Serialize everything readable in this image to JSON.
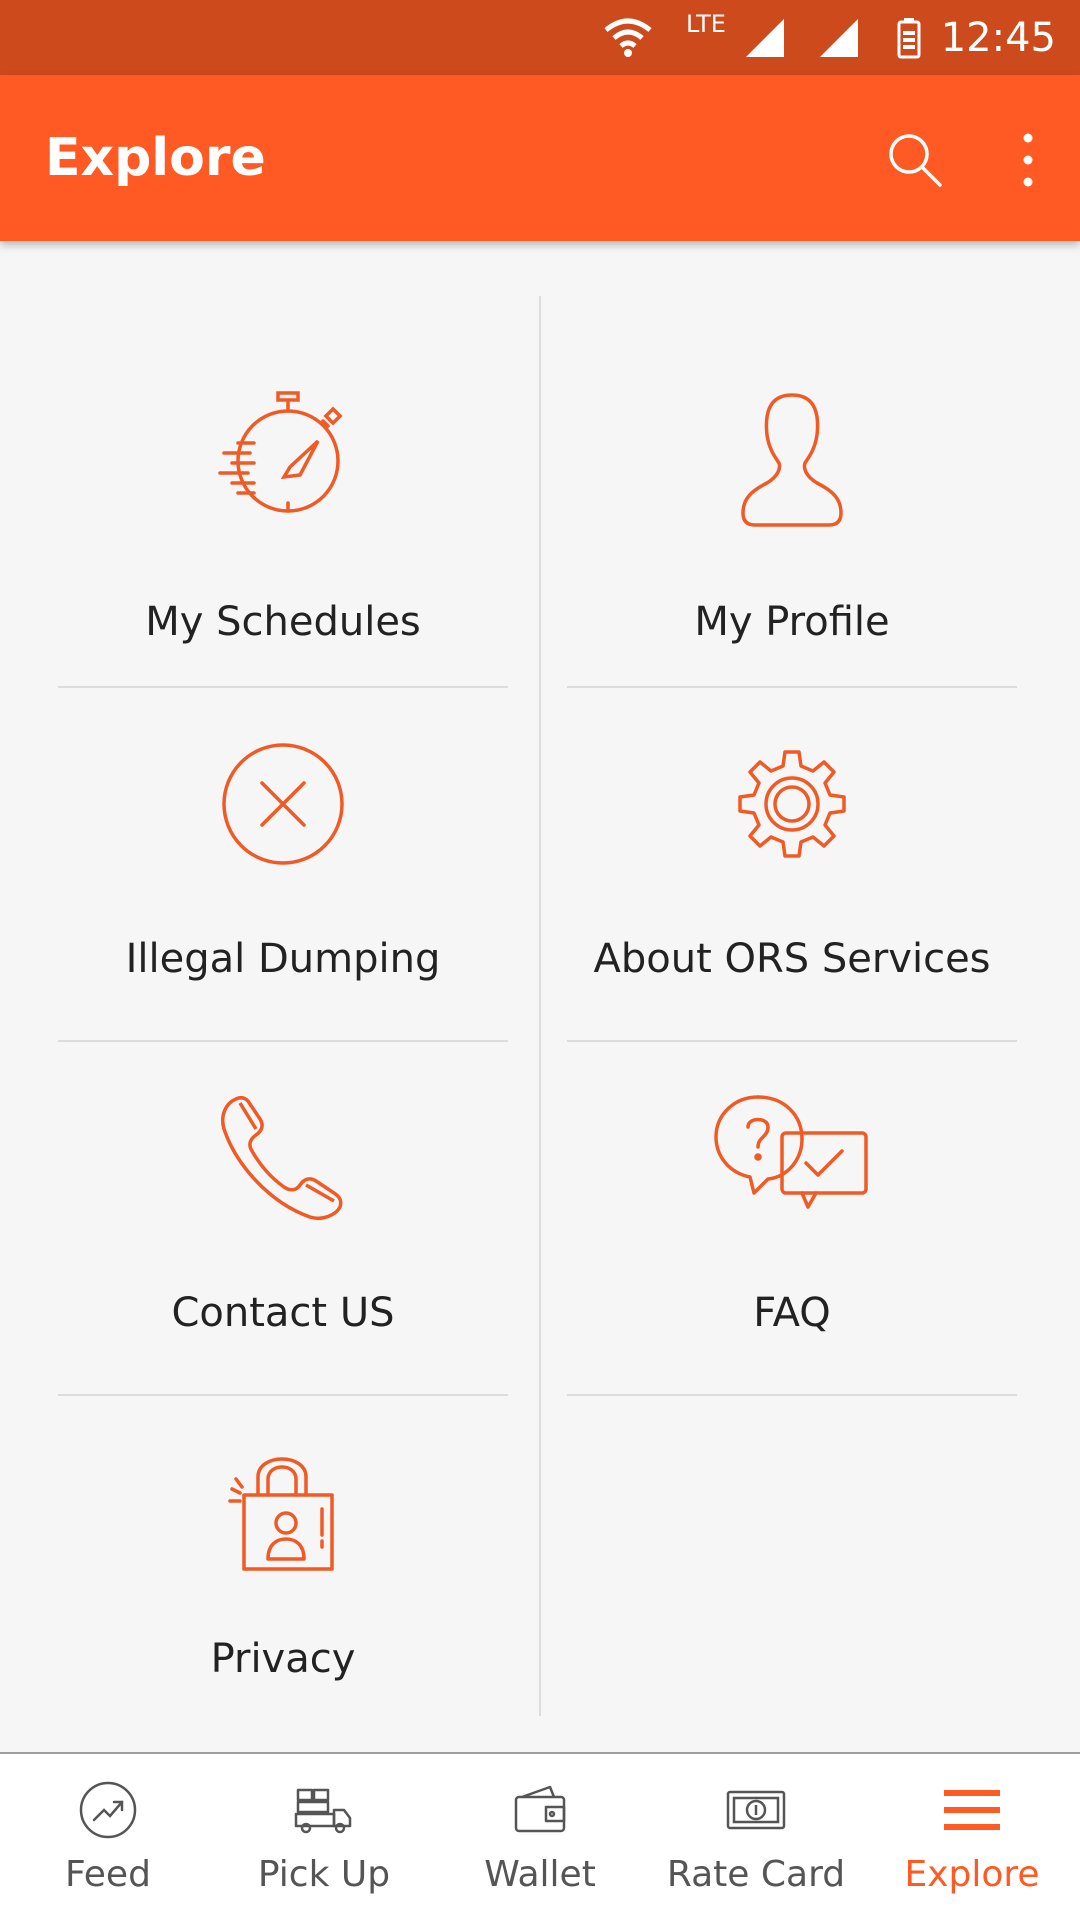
{
  "status_bar": {
    "network": "LTE",
    "time": "12:45"
  },
  "app_bar": {
    "title": "Explore"
  },
  "tiles": [
    {
      "label": "My Schedules",
      "icon": "stopwatch-icon"
    },
    {
      "label": "My Profile",
      "icon": "user-icon"
    },
    {
      "label": "Illegal Dumping",
      "icon": "close-circle-icon"
    },
    {
      "label": "About ORS Services",
      "icon": "gear-icon"
    },
    {
      "label": "Contact US",
      "icon": "phone-icon"
    },
    {
      "label": "FAQ",
      "icon": "faq-chat-icon"
    },
    {
      "label": "Privacy",
      "icon": "lock-user-icon"
    }
  ],
  "bottom_nav": [
    {
      "label": "Feed",
      "icon": "trend-icon"
    },
    {
      "label": "Pick Up",
      "icon": "truck-icon"
    },
    {
      "label": "Wallet",
      "icon": "wallet-icon"
    },
    {
      "label": "Rate Card",
      "icon": "banknote-icon"
    },
    {
      "label": "Explore",
      "icon": "menu-icon",
      "active": true
    }
  ],
  "colors": {
    "accent": "#ff5a23",
    "status_bar": "#cc4a1c",
    "icon": "#f05a24"
  }
}
